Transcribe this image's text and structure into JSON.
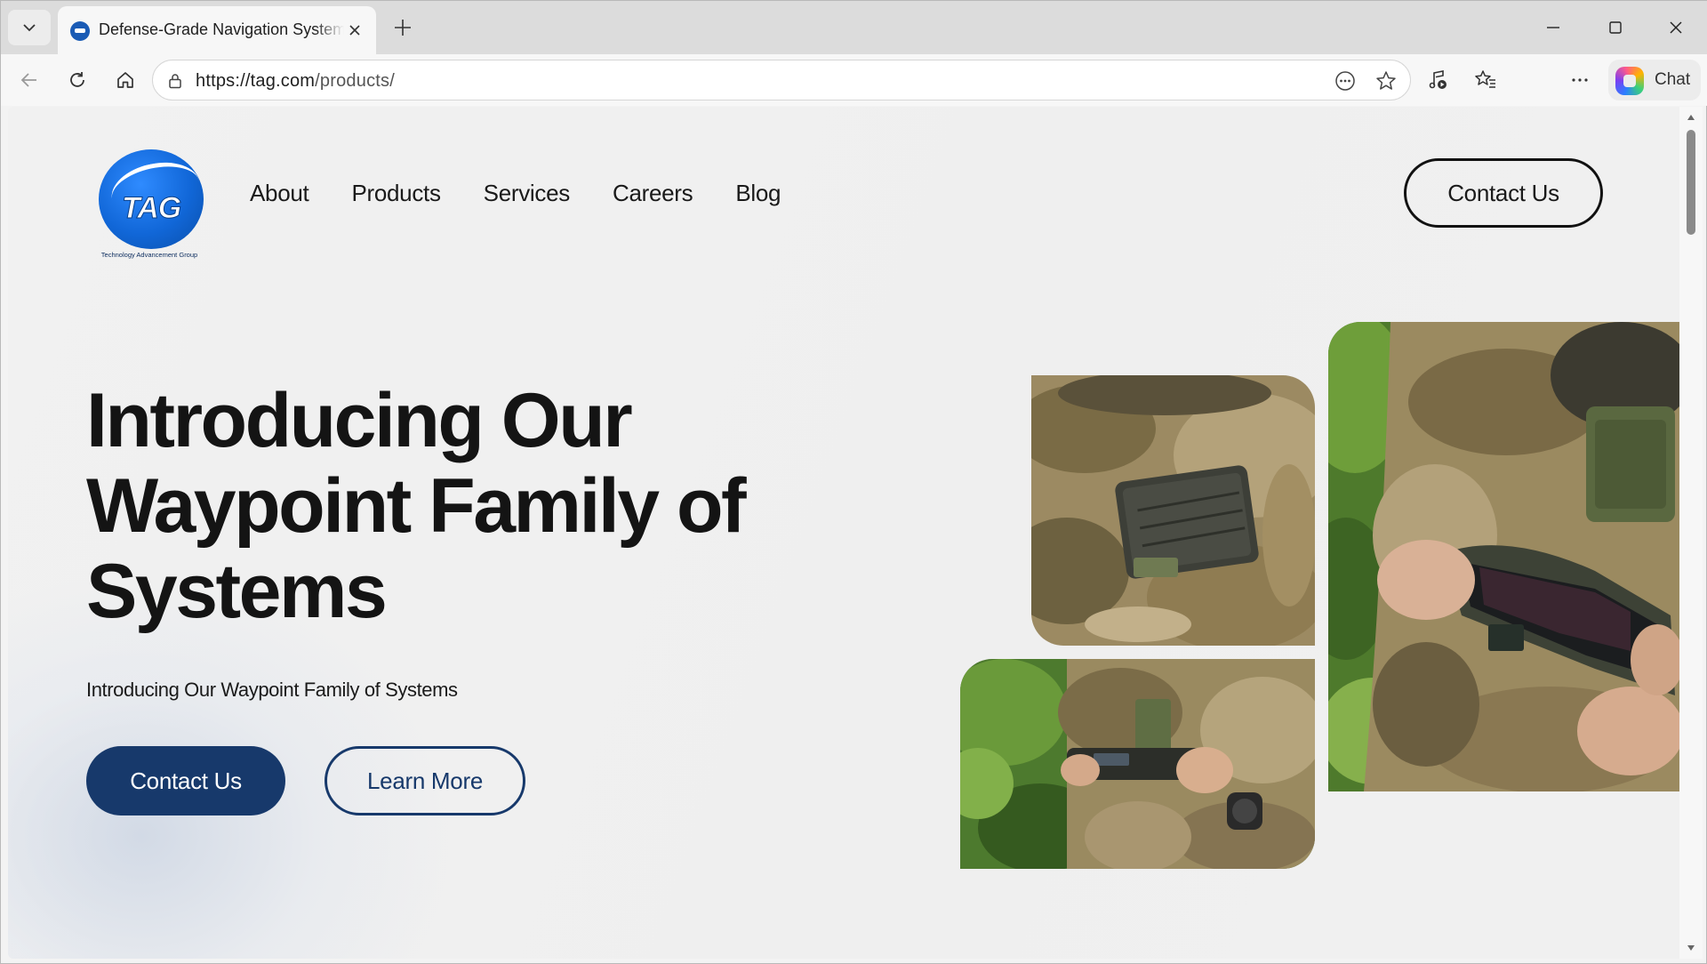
{
  "browser": {
    "tab_title": "Defense-Grade Navigation Systems | TAG",
    "url_host": "https://tag.com",
    "url_path": "/products/",
    "copilot_label": "Chat"
  },
  "site": {
    "logo_text": "TAG",
    "logo_subtext": "Technology Advancement Group",
    "nav": [
      "About",
      "Products",
      "Services",
      "Careers",
      "Blog"
    ],
    "header_cta": "Contact Us"
  },
  "hero": {
    "title_lines": [
      "Introducing Our",
      "Waypoint Family of",
      "Systems"
    ],
    "subtitle": "Introducing Our Waypoint Family of Systems",
    "primary_button": "Contact Us",
    "secondary_button": "Learn More"
  },
  "colors": {
    "brand_navy": "#17396b",
    "logo_blue": "#1167d8"
  },
  "icons": [
    "tab-list-icon",
    "tab-favicon",
    "close-icon",
    "plus-icon",
    "minimize-icon",
    "maximize-icon",
    "close-window-icon",
    "back-icon",
    "refresh-icon",
    "home-icon",
    "lock-icon",
    "reader-icon",
    "favorite-star-icon",
    "media-icon",
    "favorites-list-icon",
    "more-icon",
    "copilot-icon"
  ]
}
